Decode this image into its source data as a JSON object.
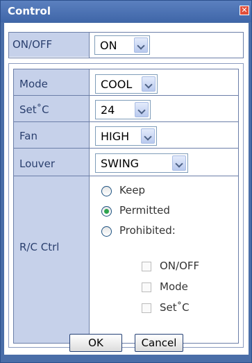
{
  "window": {
    "title": "Control",
    "close_glyph": "✕"
  },
  "onoff": {
    "label": "ON/OFF",
    "value": "ON"
  },
  "settings": {
    "mode": {
      "label": "Mode",
      "value": "COOL"
    },
    "setpoint": {
      "label": "Set˚C",
      "value": "24"
    },
    "fan": {
      "label": "Fan",
      "value": "HIGH"
    },
    "louver": {
      "label": "Louver",
      "value": "SWING"
    }
  },
  "rc_ctrl": {
    "label": "R/C Ctrl",
    "options": [
      {
        "label": "Keep",
        "selected": false
      },
      {
        "label": "Permitted",
        "selected": true
      },
      {
        "label": "Prohibited:",
        "selected": false
      }
    ],
    "prohibit_items": [
      {
        "label": "ON/OFF",
        "checked": false
      },
      {
        "label": "Mode",
        "checked": false
      },
      {
        "label": "Set˚C",
        "checked": false
      }
    ]
  },
  "buttons": {
    "ok": "OK",
    "cancel": "Cancel"
  },
  "colors": {
    "titlebar": "#4a6ea8",
    "label_bg": "#c6d1ea",
    "radio_selected": "#2ea44f"
  }
}
